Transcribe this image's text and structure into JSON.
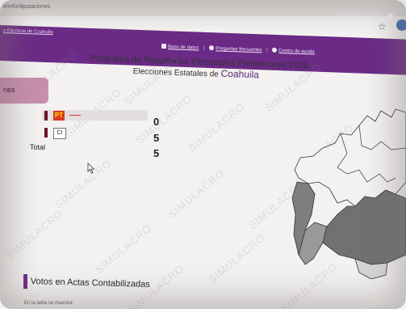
{
  "browser": {
    "url": "e/info/diputaciones"
  },
  "header": {
    "institution_link": "s Electoral de Coahuila",
    "nav": {
      "base_datos": "Base de datos",
      "preguntas": "Preguntas frecuentes",
      "ayuda": "Centro de ayuda"
    },
    "font_size_label": "A"
  },
  "titles": {
    "main": "Programa de Resultados Electorales Preliminares 2026",
    "sub_prefix": "Elecciones Estatales de",
    "state": "Coahuila"
  },
  "side_tab": {
    "label": "nes"
  },
  "results": {
    "rows": [
      {
        "party": "PT",
        "value": "0",
        "color": "#6a1426"
      },
      {
        "party": "CI",
        "value": "5",
        "color": "#6a1426"
      }
    ],
    "total_label": "Total",
    "total_value": "5"
  },
  "votes_section": {
    "title": "Votos en Actas Contabilizadas",
    "subtitle": "En la tabla se muestra"
  },
  "watermark": "SIMULACRO",
  "colors": {
    "header_purple": "#6b2a86",
    "tab_pink": "#c98fae",
    "map_dark": "#7a787b",
    "map_mid": "#9b999c"
  }
}
